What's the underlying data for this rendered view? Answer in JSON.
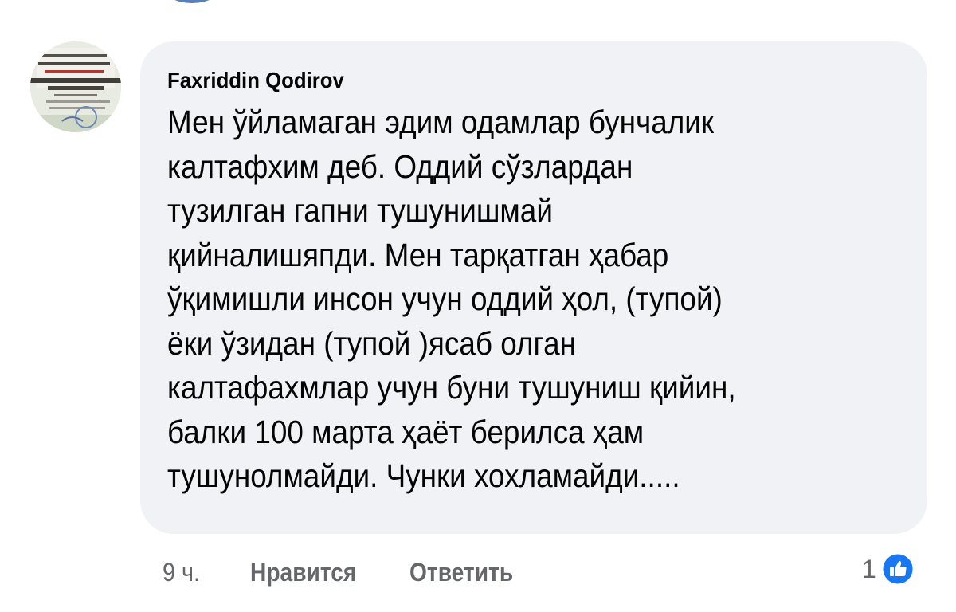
{
  "comment": {
    "author": "Faxriddin Qodirov",
    "lines": [
      "Мен ўйламаган эдим одамлар бунчалик",
      "калтафхим деб. Оддий сўзлардан",
      "тузилган гапни тушунишмай",
      "қийналишяпди. Мен тарқатган ҳабар",
      "ўқимишли инсон учун оддий ҳол,  (тупой)",
      "ёки ўзидан (тупой )ясаб олган",
      "калтафахмлар учун буни тушуниш қийин,",
      "балки 100 марта ҳаёт берилса ҳам",
      "тушунолмайди. Чунки хохламайди....."
    ],
    "timestamp": "9 ч.",
    "like_label": "Нравится",
    "reply_label": "Ответить",
    "reaction_count": "1",
    "reaction_icon": "like-thumb-icon"
  },
  "colors": {
    "bubble_bg": "#f0f2f5",
    "text": "#050505",
    "secondary_text": "#65676b",
    "like_blue": "#1877f2"
  }
}
